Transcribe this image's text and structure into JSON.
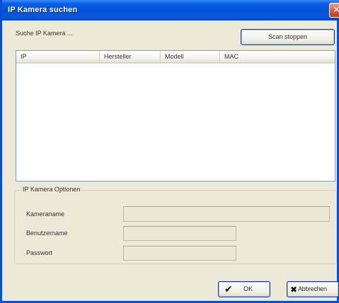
{
  "window": {
    "title": "IP Kamera suchen",
    "close_glyph": "✕"
  },
  "search": {
    "status_text": "Suche IP Kamera ...",
    "scan_button": "Scan stoppen"
  },
  "camera_list": {
    "columns": [
      "IP",
      "Hersteller",
      "Modell",
      "MAC"
    ],
    "rows": []
  },
  "options": {
    "group_title": "IP Kamera Optionen",
    "camera_name_label": "Kameraname",
    "camera_name_value": "",
    "username_label": "Benutzername",
    "username_value": "",
    "password_label": "Passwort",
    "password_value": ""
  },
  "buttons": {
    "ok_icon": "✔",
    "ok_label": "OK",
    "cancel_icon": "✖",
    "cancel_label": "Abbrechen"
  },
  "colors": {
    "titlebar": "#0453d6",
    "dialog_background": "#ece9d8",
    "close_button": "#e45a3a"
  }
}
